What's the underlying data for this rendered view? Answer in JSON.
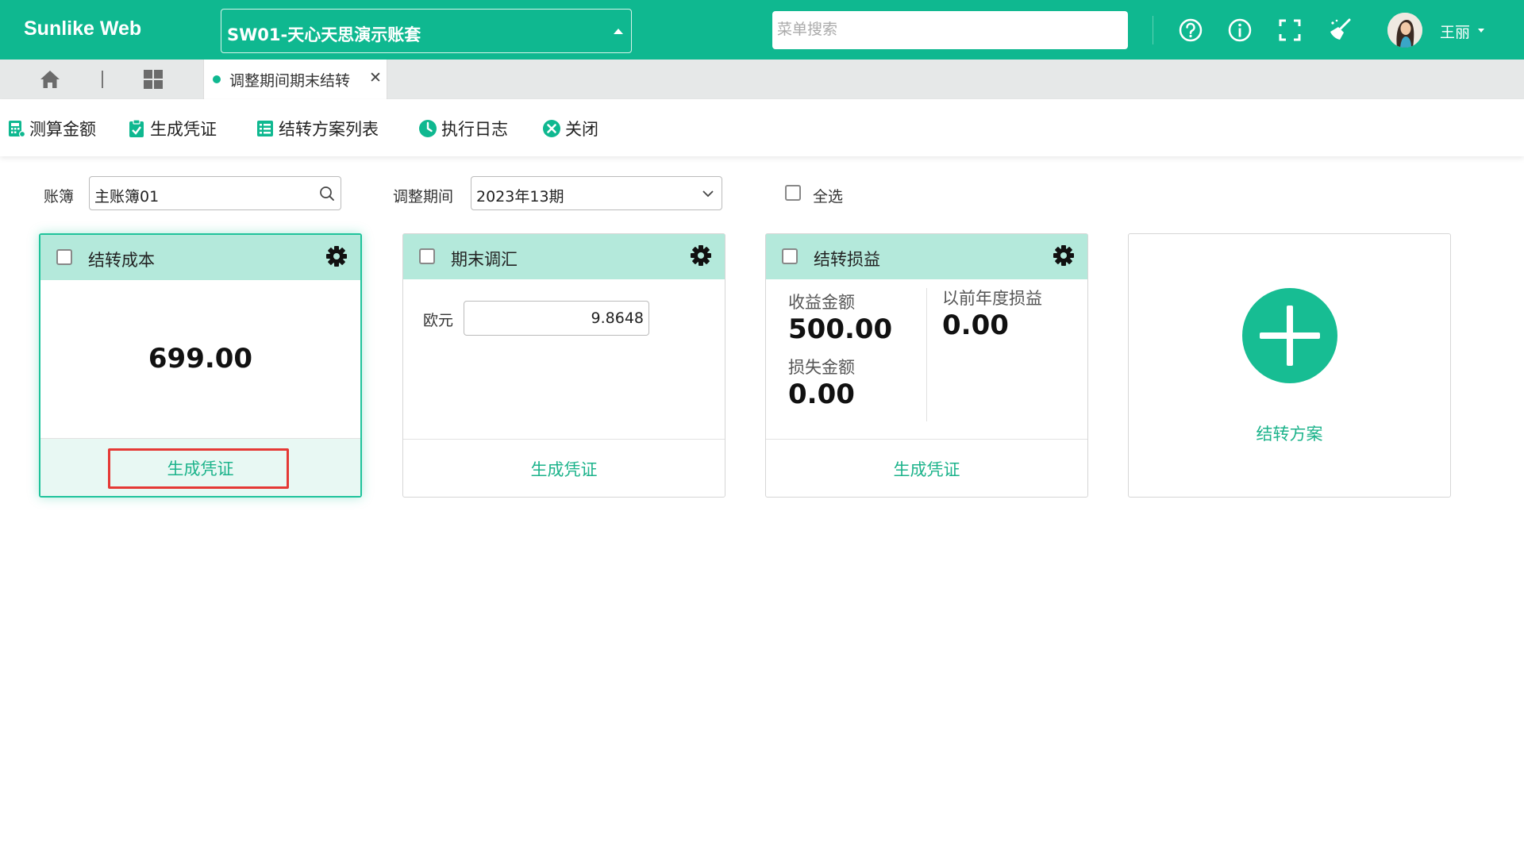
{
  "app": {
    "brand": "Sunlike Web",
    "account": "SW01-天心天思演示账套",
    "search_placeholder": "菜单搜索",
    "user": "王丽"
  },
  "tabs": {
    "active": "调整期间期末结转"
  },
  "toolbar": [
    {
      "label": "测算金额",
      "icon": "calculator-icon"
    },
    {
      "label": "生成凭证",
      "icon": "clipboard-check-icon"
    },
    {
      "label": "结转方案列表",
      "icon": "list-icon"
    },
    {
      "label": "执行日志",
      "icon": "clock-icon"
    },
    {
      "label": "关闭",
      "icon": "close-circle-icon"
    }
  ],
  "filters": {
    "ledger_label": "账簿",
    "ledger_value": "主账簿01",
    "period_label": "调整期间",
    "period_value": "2023年13期",
    "select_all_label": "全选"
  },
  "cards": {
    "cost": {
      "title": "结转成本",
      "amount": "699.00",
      "action": "生成凭证"
    },
    "fx": {
      "title": "期末调汇",
      "currency": "欧元",
      "rate": "9.8648",
      "action": "生成凭证"
    },
    "pl": {
      "title": "结转损益",
      "income_label": "收益金额",
      "income": "500.00",
      "loss_label": "损失金额",
      "loss": "0.00",
      "prior_label": "以前年度损益",
      "prior": "0.00",
      "action": "生成凭证"
    },
    "add": {
      "label": "结转方案"
    }
  },
  "colors": {
    "brand": "#0fb890",
    "card_head": "#b4e9db",
    "link": "#1cb38b",
    "highlight": "#e53935"
  }
}
